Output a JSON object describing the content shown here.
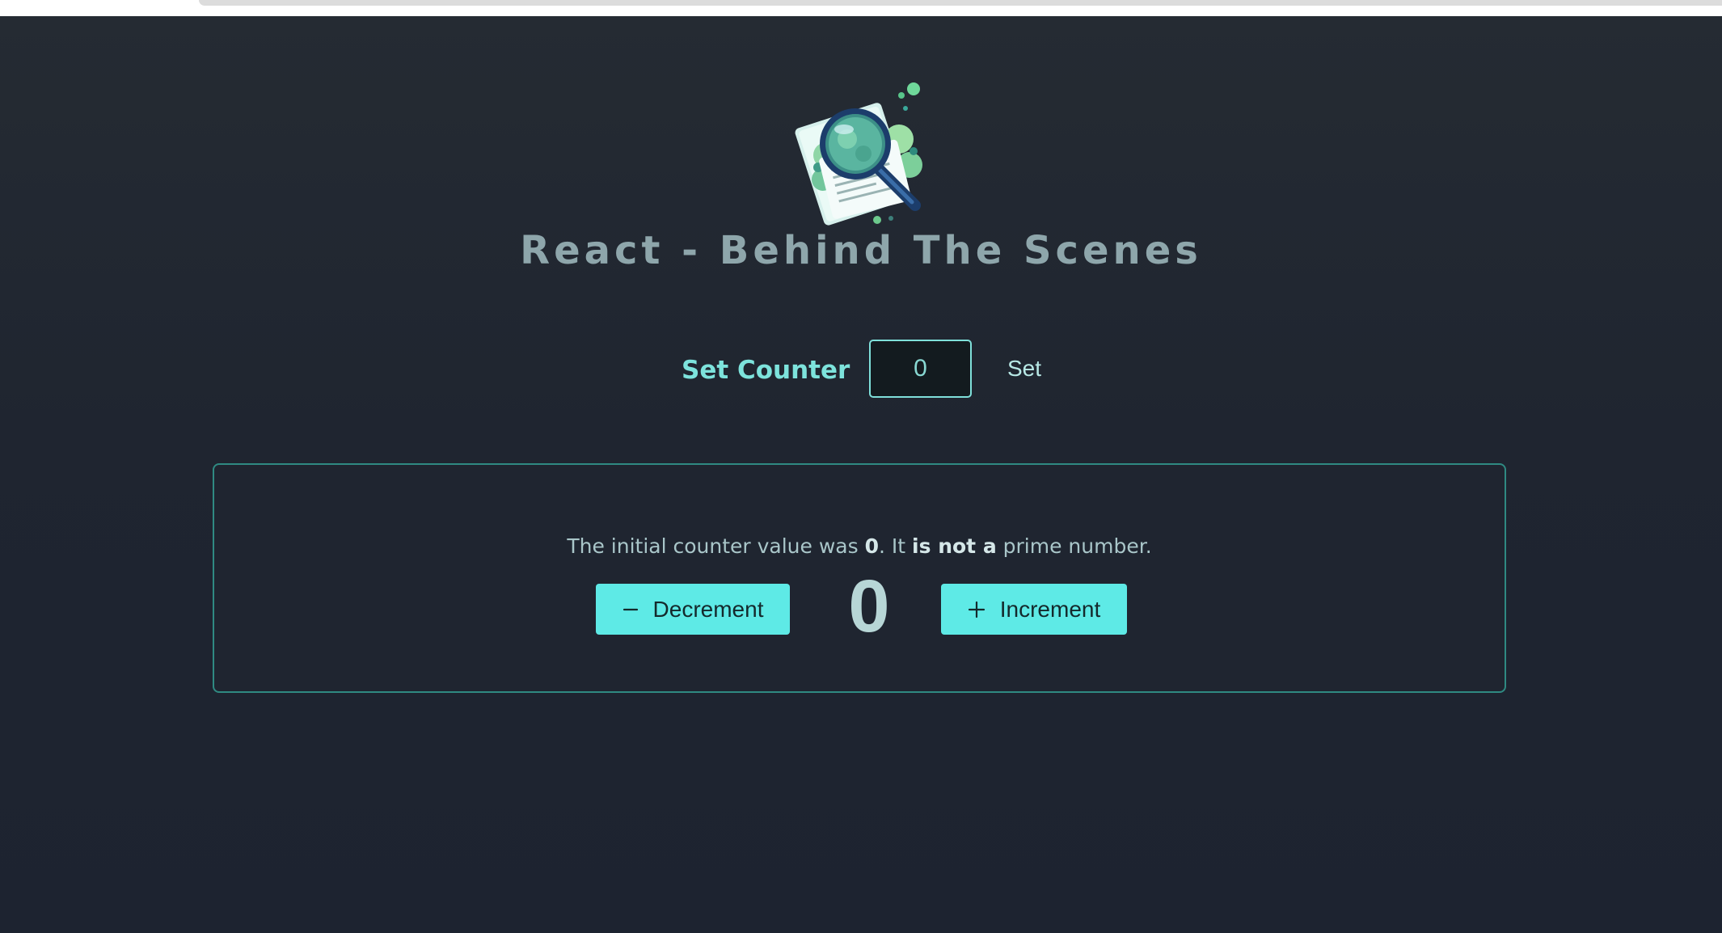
{
  "header": {
    "title": "React - Behind The Scenes",
    "logo_icon": "magnifying-glass-over-documents-logo"
  },
  "set_counter": {
    "label": "Set Counter",
    "input_value": "0",
    "button_label": "Set"
  },
  "counter": {
    "info_prefix": "The initial counter value was",
    "initial_value": "0",
    "info_middle": ". It",
    "prime_status": "is not a",
    "info_suffix": "prime number.",
    "current_value": "0",
    "decrement_label": "Decrement",
    "increment_label": "Increment",
    "decrement_icon": "minus-icon",
    "increment_icon": "plus-icon"
  },
  "colors": {
    "background": "#1f2530",
    "accent": "#5eeae6",
    "title": "#8ea6ab",
    "label": "#7de3dc",
    "card_border": "#2f8a82"
  }
}
